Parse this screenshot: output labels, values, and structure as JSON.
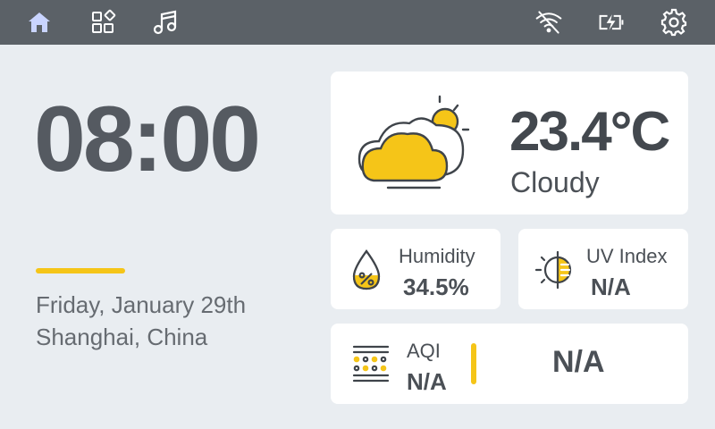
{
  "topbar": {
    "icons": [
      "home-icon",
      "apps-icon",
      "music-icon",
      "wifi-off-icon",
      "battery-charging-icon",
      "gear-icon"
    ],
    "active_color": "#c9d4ff",
    "icon_color": "#ffffff"
  },
  "clock": {
    "time": "08:00"
  },
  "date": {
    "line": "Friday, January 29th",
    "location": "Shanghai, China"
  },
  "weather": {
    "temperature": "23.4°C",
    "condition": "Cloudy",
    "icon": "partly-cloudy-icon"
  },
  "humidity": {
    "label": "Humidity",
    "value": "34.5%",
    "icon": "humidity-drop-icon"
  },
  "uv": {
    "label": "UV Index",
    "value": "N/A",
    "icon": "uv-sun-icon"
  },
  "aqi": {
    "label": "AQI",
    "value": "N/A",
    "big_value": "N/A",
    "icon": "aqi-filter-icon"
  },
  "colors": {
    "accent": "#f5c518",
    "topbar": "#5b6167",
    "background": "#e9edf1",
    "card": "#ffffff"
  }
}
